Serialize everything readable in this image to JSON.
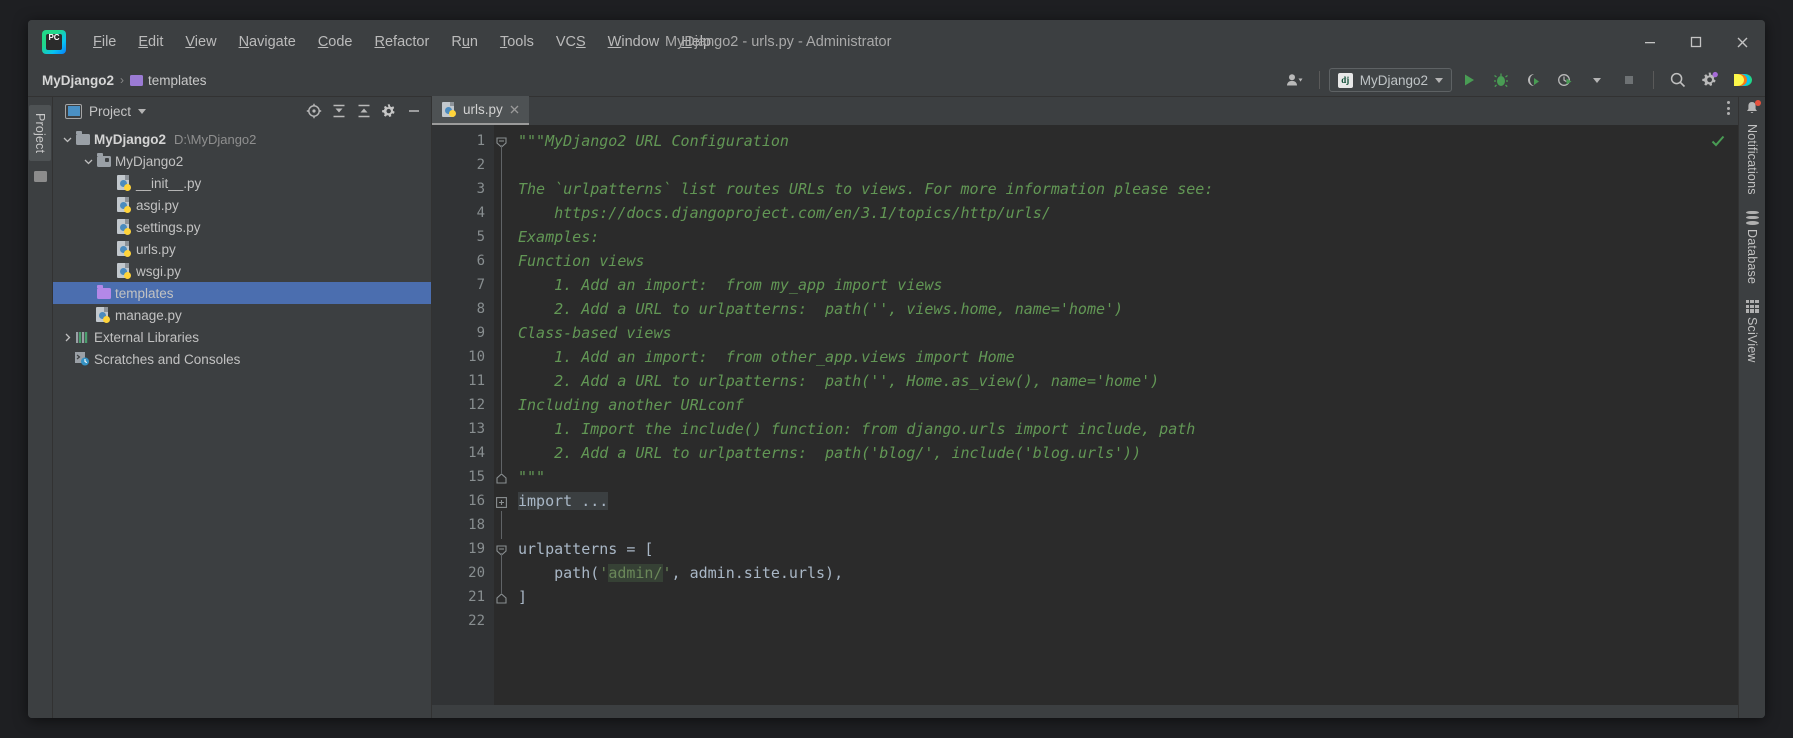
{
  "window": {
    "title": "MyDjango2 - urls.py - Administrator",
    "app_icon": "pycharm-logo",
    "logo_text": "PC",
    "controls": {
      "minimize": "minimize-icon",
      "maximize": "maximize-icon",
      "close": "close-icon"
    }
  },
  "menu": [
    {
      "label": "File",
      "mnemonic": "F"
    },
    {
      "label": "Edit",
      "mnemonic": "E"
    },
    {
      "label": "View",
      "mnemonic": "V"
    },
    {
      "label": "Navigate",
      "mnemonic": "N"
    },
    {
      "label": "Code",
      "mnemonic": "C"
    },
    {
      "label": "Refactor",
      "mnemonic": "R"
    },
    {
      "label": "Run",
      "mnemonic": "u"
    },
    {
      "label": "Tools",
      "mnemonic": "T"
    },
    {
      "label": "VCS",
      "mnemonic": "S"
    },
    {
      "label": "Window",
      "mnemonic": "W"
    },
    {
      "label": "Help",
      "mnemonic": "H"
    }
  ],
  "navbar": {
    "breadcrumbs": [
      {
        "label": "MyDjango2",
        "icon": "",
        "bold": true
      },
      {
        "label": "templates",
        "icon": "folder-purple-icon",
        "bold": false
      }
    ],
    "separator": "›",
    "run_config": {
      "name": "MyDjango2",
      "icon_text": "dj"
    },
    "buttons": [
      "user-icon",
      "run-icon",
      "debug-icon",
      "coverage-icon",
      "profile-icon",
      "stop-icon",
      "search-everywhere-icon",
      "settings-icon",
      "updates-icon"
    ]
  },
  "left_rail": {
    "tabs": [
      "Project"
    ],
    "icons": [
      "structure-icon"
    ]
  },
  "project_panel": {
    "title": "Project",
    "title_icon": "project-view-icon",
    "tools": [
      "select-opened-file-icon",
      "expand-all-icon",
      "collapse-all-icon",
      "settings-icon",
      "hide-icon"
    ],
    "tree": [
      {
        "label": "MyDjango2",
        "path": "D:\\MyDjango2",
        "icon": "folder-icon",
        "arrow": "expanded",
        "indent": 0,
        "bold": true,
        "selected": false
      },
      {
        "label": "MyDjango2",
        "path": "",
        "icon": "module-folder-icon",
        "arrow": "expanded",
        "indent": 1,
        "bold": false,
        "selected": false
      },
      {
        "label": "__init__.py",
        "path": "",
        "icon": "python-file-icon",
        "arrow": "none",
        "indent": 2,
        "bold": false,
        "selected": false
      },
      {
        "label": "asgi.py",
        "path": "",
        "icon": "python-file-icon",
        "arrow": "none",
        "indent": 2,
        "bold": false,
        "selected": false
      },
      {
        "label": "settings.py",
        "path": "",
        "icon": "python-file-icon",
        "arrow": "none",
        "indent": 2,
        "bold": false,
        "selected": false
      },
      {
        "label": "urls.py",
        "path": "",
        "icon": "python-file-icon",
        "arrow": "none",
        "indent": 2,
        "bold": false,
        "selected": false
      },
      {
        "label": "wsgi.py",
        "path": "",
        "icon": "python-file-icon",
        "arrow": "none",
        "indent": 2,
        "bold": false,
        "selected": false
      },
      {
        "label": "templates",
        "path": "",
        "icon": "folder-purple-icon",
        "arrow": "none",
        "indent": 1,
        "bold": false,
        "selected": true
      },
      {
        "label": "manage.py",
        "path": "",
        "icon": "python-file-icon",
        "arrow": "none",
        "indent": 1,
        "bold": false,
        "selected": false
      },
      {
        "label": "External Libraries",
        "path": "",
        "icon": "library-icon",
        "arrow": "collapsed",
        "indent": 0,
        "bold": false,
        "selected": false
      },
      {
        "label": "Scratches and Consoles",
        "path": "",
        "icon": "scratches-icon",
        "arrow": "none",
        "indent": 0,
        "bold": false,
        "selected": false
      }
    ]
  },
  "editor": {
    "tabs": [
      {
        "label": "urls.py",
        "icon": "python-file-icon",
        "active": true,
        "close": "close-icon"
      }
    ],
    "options_icon": "more-options-icon",
    "inspection_status": "ok-check-icon",
    "lines": [
      {
        "num": "1",
        "fold": "start",
        "segments": [
          {
            "t": "\"\"\"MyDjango2 URL Configuration",
            "c": "doc"
          }
        ]
      },
      {
        "num": "2",
        "fold": "bar",
        "segments": [
          {
            "t": "",
            "c": "doc"
          }
        ]
      },
      {
        "num": "3",
        "fold": "bar",
        "segments": [
          {
            "t": "The `urlpatterns` list routes URLs to views. For more information please see:",
            "c": "doc"
          }
        ]
      },
      {
        "num": "4",
        "fold": "bar",
        "segments": [
          {
            "t": "    ",
            "c": "doc"
          },
          {
            "t": "https://docs.djangoproject.com/en/3.1/topics/http/urls/",
            "c": "doc lnk"
          }
        ]
      },
      {
        "num": "5",
        "fold": "bar",
        "segments": [
          {
            "t": "Examples:",
            "c": "doc"
          }
        ]
      },
      {
        "num": "6",
        "fold": "bar",
        "segments": [
          {
            "t": "Function views",
            "c": "doc"
          }
        ]
      },
      {
        "num": "7",
        "fold": "bar",
        "segments": [
          {
            "t": "    1. Add an import:  from my_app import views",
            "c": "doc"
          }
        ]
      },
      {
        "num": "8",
        "fold": "bar",
        "segments": [
          {
            "t": "    2. Add a URL to urlpatterns:  path('', views.home, name='home')",
            "c": "doc"
          }
        ]
      },
      {
        "num": "9",
        "fold": "bar",
        "segments": [
          {
            "t": "Class-based views",
            "c": "doc"
          }
        ]
      },
      {
        "num": "10",
        "fold": "bar",
        "segments": [
          {
            "t": "    1. Add an import:  from other_app.views import Home",
            "c": "doc"
          }
        ]
      },
      {
        "num": "11",
        "fold": "bar",
        "segments": [
          {
            "t": "    2. Add a URL to urlpatterns:  path('', Home.as_view(), name='home')",
            "c": "doc"
          }
        ]
      },
      {
        "num": "12",
        "fold": "bar",
        "segments": [
          {
            "t": "Including another URLconf",
            "c": "doc"
          }
        ]
      },
      {
        "num": "13",
        "fold": "bar",
        "segments": [
          {
            "t": "    1. Import the include() function: from django.urls import include, path",
            "c": "doc"
          }
        ]
      },
      {
        "num": "14",
        "fold": "bar",
        "segments": [
          {
            "t": "    2. Add a URL to urlpatterns:  path('blog/', include('blog.urls'))",
            "c": "doc"
          }
        ]
      },
      {
        "num": "15",
        "fold": "end",
        "segments": [
          {
            "t": "\"\"\"",
            "c": "doc"
          }
        ]
      },
      {
        "num": "16",
        "fold": "plus",
        "segments": [
          {
            "t": "import ...",
            "c": "folded"
          }
        ]
      },
      {
        "num": "18",
        "fold": "bar2",
        "segments": [
          {
            "t": "",
            "c": "id"
          }
        ]
      },
      {
        "num": "19",
        "fold": "start2",
        "segments": [
          {
            "t": "urlpatterns",
            "c": "id"
          },
          {
            "t": " = [",
            "c": "id"
          }
        ]
      },
      {
        "num": "20",
        "fold": "bar2",
        "segments": [
          {
            "t": "    path(",
            "c": "id"
          },
          {
            "t": "'",
            "c": "str"
          },
          {
            "t": "admin/",
            "c": "str inj"
          },
          {
            "t": "'",
            "c": "str"
          },
          {
            "t": ", admin.site.urls),",
            "c": "id"
          }
        ]
      },
      {
        "num": "21",
        "fold": "end2",
        "segments": [
          {
            "t": "]",
            "c": "id"
          }
        ]
      },
      {
        "num": "22",
        "fold": "none",
        "segments": [
          {
            "t": "",
            "c": "id"
          }
        ]
      }
    ]
  },
  "right_rail": [
    {
      "label": "Notifications",
      "icon": "bell-icon",
      "badge": true
    },
    {
      "label": "Database",
      "icon": "database-icon",
      "badge": false
    },
    {
      "label": "SciView",
      "icon": "sciview-grid-icon",
      "badge": false
    }
  ],
  "colors": {
    "accent_selection": "#4b6eaf",
    "docstring_green": "#629755",
    "string_green": "#6a8759",
    "keyword_orange": "#cc7832",
    "panel_bg": "#3c3f41",
    "editor_bg": "#2b2b2b",
    "gutter_bg": "#313335"
  }
}
